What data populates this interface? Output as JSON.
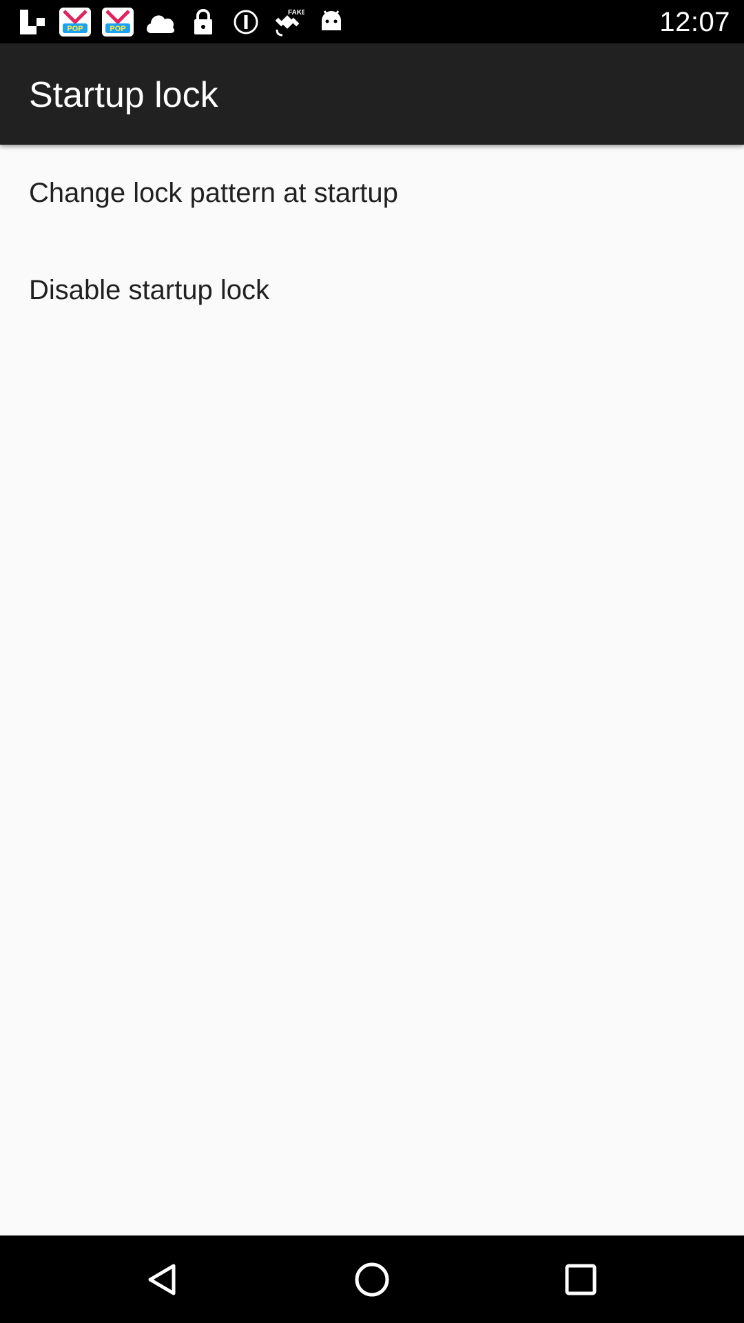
{
  "status_bar": {
    "time": "12:07",
    "left_icons": [
      "flipboard-icon",
      "pop-app-icon",
      "pop-app-icon",
      "cloud-icon",
      "lock-icon",
      "info-circle-icon",
      "fake-gps-icon",
      "android-icon"
    ],
    "right_icons": []
  },
  "app_bar": {
    "title": "Startup lock"
  },
  "menu": {
    "items": [
      {
        "label": "Change lock pattern at startup"
      },
      {
        "label": "Disable startup lock"
      }
    ]
  },
  "nav_bar": {
    "buttons": [
      "back-icon",
      "home-icon",
      "recents-icon"
    ]
  },
  "colors": {
    "status_bar_bg": "#000000",
    "app_bar_bg": "#212121",
    "content_bg": "#fafafa",
    "text_primary": "#212121",
    "on_dark": "#ffffff"
  }
}
